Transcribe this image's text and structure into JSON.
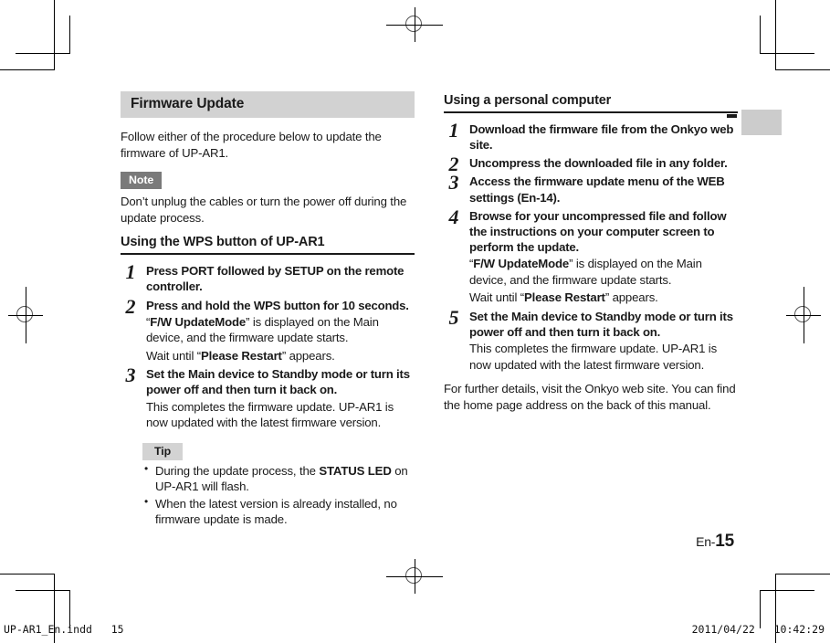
{
  "document": {
    "folio_prefix": "En-",
    "folio_number": "15"
  },
  "left_column": {
    "section_title": "Firmware Update",
    "intro": "Follow either of the procedure below to update the firmware of UP-AR1.",
    "note_badge": "Note",
    "note_text": "Don’t unplug the cables or turn the power off during the update process.",
    "subsection_title": "Using the WPS button of UP-AR1",
    "steps": [
      {
        "num": "1",
        "title": "Press PORT followed by SETUP on the remote controller.",
        "details": []
      },
      {
        "num": "2",
        "title": "Press and hold the WPS button for 10 seconds.",
        "details": [
          "“F/W UpdateMode” is displayed on the Main device, and the firmware update starts.",
          "Wait until “Please Restart” appears."
        ]
      },
      {
        "num": "3",
        "title": "Set the Main device to Standby mode or turn its power off and then turn it back on.",
        "details": [
          "This completes the firmware update. UP-AR1 is now updated with the latest firmware version."
        ]
      }
    ],
    "tip_badge": "Tip",
    "tips": [
      "During the update process, the STATUS LED on UP-AR1 will flash.",
      "When the latest version is already installed, no firmware update is made."
    ]
  },
  "right_column": {
    "subsection_title": "Using a personal computer",
    "steps": [
      {
        "num": "1",
        "title": "Download the firmware file from the Onkyo web site.",
        "details": []
      },
      {
        "num": "2",
        "title": "Uncompress the downloaded file in any folder.",
        "details": []
      },
      {
        "num": "3",
        "title": "Access the firmware update menu of the WEB settings (En-14).",
        "details": []
      },
      {
        "num": "4",
        "title": "Browse for your uncompressed file and follow the instructions on your computer screen to perform the update.",
        "details": [
          "“F/W UpdateMode” is displayed on the Main device, and the firmware update starts.",
          "Wait until “Please Restart” appears."
        ]
      },
      {
        "num": "5",
        "title": "Set the Main device to Standby mode or turn its power off and then turn it back on.",
        "details": [
          "This completes the firmware update. UP-AR1 is now updated with the latest firmware version."
        ]
      }
    ],
    "closing": "For further details, visit the Onkyo web site. You can find the home page address on the back of this manual."
  },
  "production_footer": {
    "file_and_page": "UP-AR1_En.indd   15",
    "date_and_time": "2011/04/22   10:42:29"
  }
}
